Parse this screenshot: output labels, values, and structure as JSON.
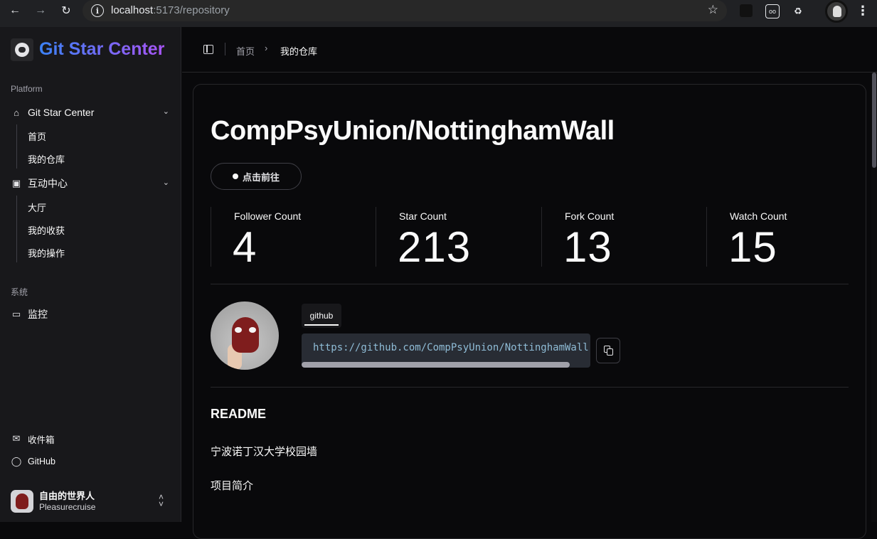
{
  "browser": {
    "url_host": "localhost",
    "url_path": ":5173/repository"
  },
  "sidebar": {
    "brand": "Git Star Center",
    "platform_label": "Platform",
    "groups": [
      {
        "label": "Git Star Center",
        "icon": "home-icon",
        "items": [
          "首页",
          "我的仓库"
        ]
      },
      {
        "label": "互动中心",
        "icon": "terminal-icon",
        "items": [
          "大厅",
          "我的收获",
          "我的操作"
        ]
      }
    ],
    "system_label": "系统",
    "monitor": "监控",
    "bottom": {
      "inbox": "收件箱",
      "github": "GitHub"
    },
    "user": {
      "name": "自由的世界人",
      "handle": "Pleasurecruise"
    }
  },
  "breadcrumb": {
    "home": "首页",
    "current": "我的仓库"
  },
  "repo": {
    "title": "CompPsyUnion/NottinghamWall",
    "visit_label": "点击前往",
    "stats": [
      {
        "label": "Follower Count",
        "value": "4"
      },
      {
        "label": "Star Count",
        "value": "213"
      },
      {
        "label": "Fork Count",
        "value": "13"
      },
      {
        "label": "Watch Count",
        "value": "15"
      }
    ],
    "tab_label": "github",
    "clone_url": "https://github.com/CompPsyUnion/NottinghamWall.git",
    "readme_heading": "README",
    "readme_lines": [
      "宁波诺丁汉大学校园墙",
      "项目简介"
    ]
  }
}
